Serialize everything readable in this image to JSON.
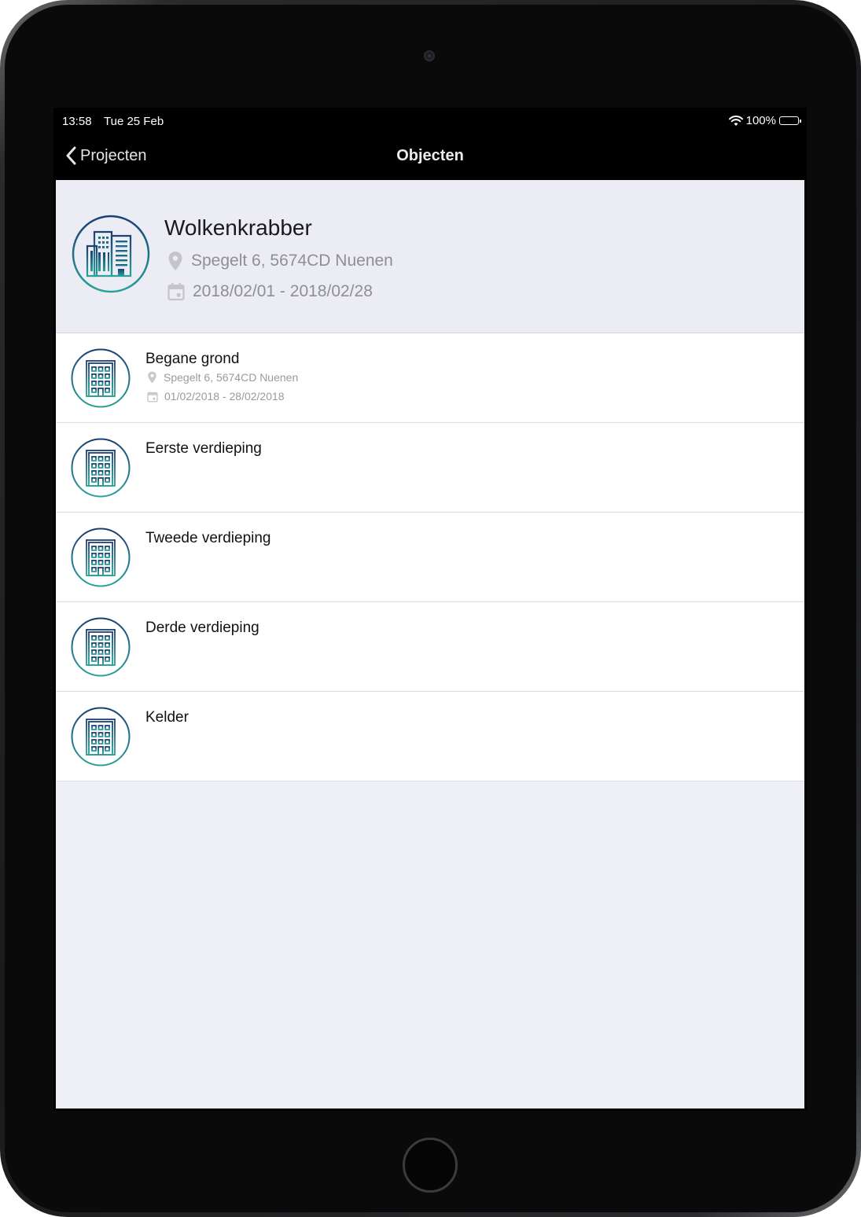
{
  "statusbar": {
    "time": "13:58",
    "date": "Tue 25 Feb",
    "battery": "100%"
  },
  "navbar": {
    "back_label": "Projecten",
    "title": "Objecten"
  },
  "project": {
    "name": "Wolkenkrabber",
    "address": "Spegelt 6, 5674CD Nuenen",
    "dates": "2018/02/01 - 2018/02/28"
  },
  "objects": [
    {
      "name": "Begane grond",
      "address": "Spegelt 6, 5674CD Nuenen",
      "dates": "01/02/2018 - 28/02/2018"
    },
    {
      "name": "Eerste verdieping"
    },
    {
      "name": "Tweede verdieping"
    },
    {
      "name": "Derde verdieping"
    },
    {
      "name": "Kelder"
    }
  ],
  "colors": {
    "icon_gradient_start": "#1b3f72",
    "icon_gradient_end": "#2aa19a",
    "background": "#efeff7",
    "navbar": "#000000"
  }
}
